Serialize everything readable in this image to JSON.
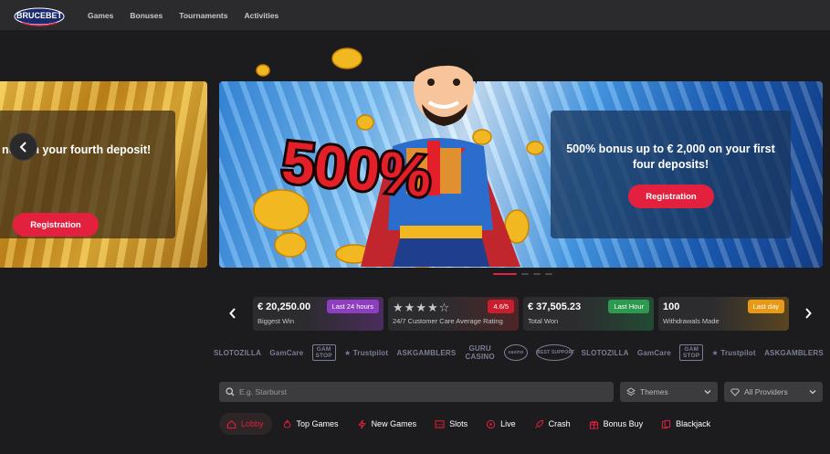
{
  "header": {
    "logo_text": "BRUCEBET",
    "nav": [
      "Games",
      "Bonuses",
      "Tournaments",
      "Activities"
    ]
  },
  "carousel": {
    "slide_prev": {
      "title": "nus on your fourth deposit!",
      "button": "Registration"
    },
    "slide_main": {
      "title": "500% bonus up to € 2,000 on your first four deposits!",
      "button": "Registration",
      "art_text": "500%"
    },
    "dots_count": 4,
    "active_dot": 1
  },
  "stats": [
    {
      "value": "€ 20,250.00",
      "label": "Biggest Win",
      "badge": "Last 24 hours",
      "badge_color": "#8e3fc0"
    },
    {
      "rating_stars": 4.5,
      "label": "24/7 Customer Care Average Rating",
      "badge": "4.6/5",
      "badge_color": "#c81e2d"
    },
    {
      "value": "€ 37,505.23",
      "label": "Total Won",
      "badge": "Last Hour",
      "badge_color": "#2e9a4f"
    },
    {
      "value": "100",
      "label": "Withdrawals Made",
      "badge": "Last day",
      "badge_color": "#e79a17"
    }
  ],
  "partners": [
    "SLOTOZILLA",
    "GamCare",
    "GAM STOP",
    "Trustpilot",
    "ASKGAMBLERS",
    "GURU CASINO",
    "casino",
    "BEST SUPPORT",
    "SLOTOZILLA",
    "GamCare",
    "GAM STOP",
    "Trustpilot",
    "ASKGAMBLERS"
  ],
  "search": {
    "placeholder": "E.g. Starburst"
  },
  "filters": {
    "themes": "Themes",
    "providers": "All Providers"
  },
  "categories": [
    {
      "label": "Lobby",
      "icon": "house-icon",
      "active": true
    },
    {
      "label": "Top Games",
      "icon": "flame-icon"
    },
    {
      "label": "New Games",
      "icon": "lightning-icon"
    },
    {
      "label": "Slots",
      "icon": "slot-icon"
    },
    {
      "label": "Live",
      "icon": "live-icon"
    },
    {
      "label": "Crash",
      "icon": "rocket-icon"
    },
    {
      "label": "Bonus Buy",
      "icon": "gift-icon"
    },
    {
      "label": "Blackjack",
      "icon": "cards-icon"
    }
  ],
  "colors": {
    "accent": "#e3203d",
    "background": "#1c1c1e",
    "header": "#2b2b2d"
  }
}
